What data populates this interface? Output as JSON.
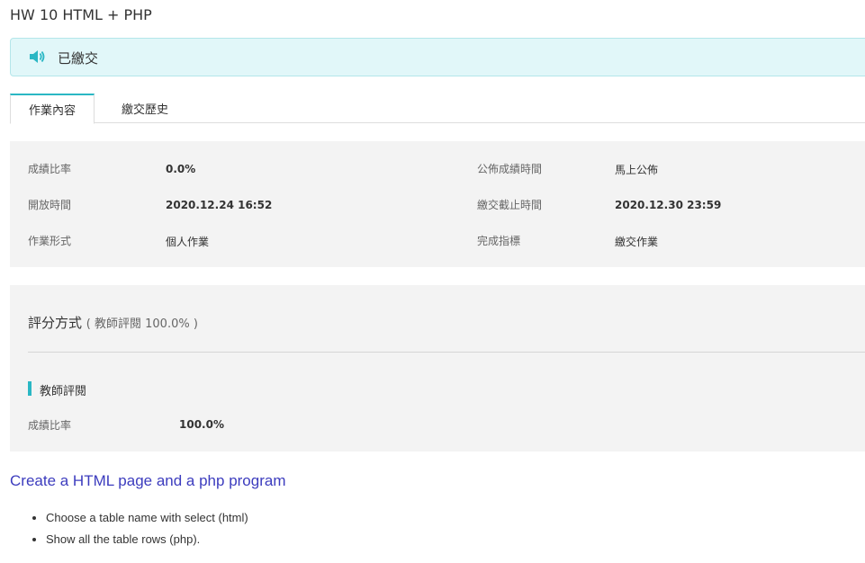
{
  "page": {
    "title": "HW 10 HTML + PHP"
  },
  "status": {
    "text": "已繳交",
    "accent_color": "#2ab7c4",
    "icon": "speaker-icon"
  },
  "tabs": [
    {
      "label": "作業內容",
      "active": true
    },
    {
      "label": "繳交歷史",
      "active": false
    }
  ],
  "info": {
    "left": [
      {
        "label": "成績比率",
        "value": "0.0%"
      },
      {
        "label": "開放時間",
        "value": "2020.12.24 16:52"
      },
      {
        "label": "作業形式",
        "value": "個人作業"
      }
    ],
    "right": [
      {
        "label": "公佈成績時間",
        "value": "馬上公佈"
      },
      {
        "label": "繳交截止時間",
        "value": "2020.12.30 23:59"
      },
      {
        "label": "完成指標",
        "value": "繳交作業"
      }
    ]
  },
  "grading": {
    "title": "評分方式",
    "subtitle": "( 教師評閱 100.0% )",
    "section_label": "教師評閱",
    "ratio_label": "成績比率",
    "ratio_value": "100.0%"
  },
  "description": {
    "title": "Create a HTML page and a php program",
    "items": [
      "Choose a table name with select (html)",
      "Show all the table rows (php)."
    ]
  }
}
